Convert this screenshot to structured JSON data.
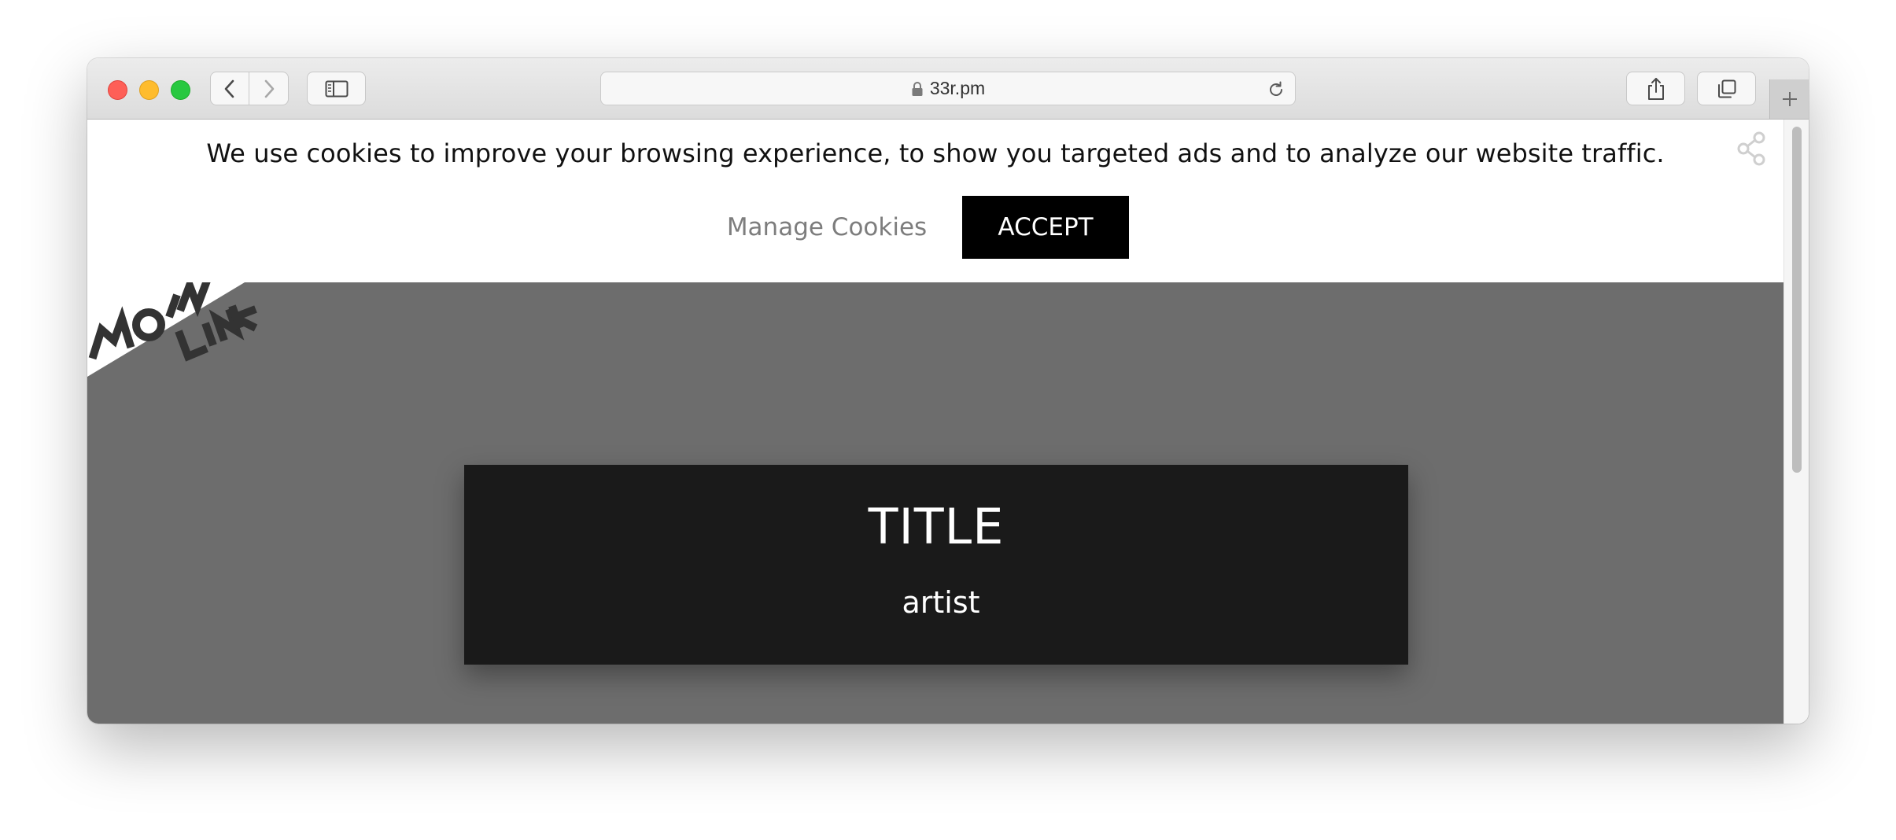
{
  "browser": {
    "url": "33r.pm",
    "icons": {
      "back": "chevron-left-icon",
      "forward": "chevron-right-icon",
      "sidebar": "sidebar-icon",
      "lock": "lock-icon",
      "reload": "reload-icon",
      "share": "share-icon",
      "tabs": "tabs-icon",
      "new_tab": "plus-icon"
    }
  },
  "cookie_banner": {
    "message": "We use cookies to improve your browsing experience, to show you targeted ads and to analyze our website traffic.",
    "manage_label": "Manage Cookies",
    "accept_label": "ACCEPT"
  },
  "page": {
    "logo_text": "MOIN LINK",
    "share_icon": "share-nodes-icon",
    "card": {
      "title": "TITLE",
      "artist": "artist"
    },
    "colors": {
      "hero_bg": "#6d6d6d",
      "card_bg": "#1a1a1a",
      "accept_bg": "#000000"
    }
  }
}
